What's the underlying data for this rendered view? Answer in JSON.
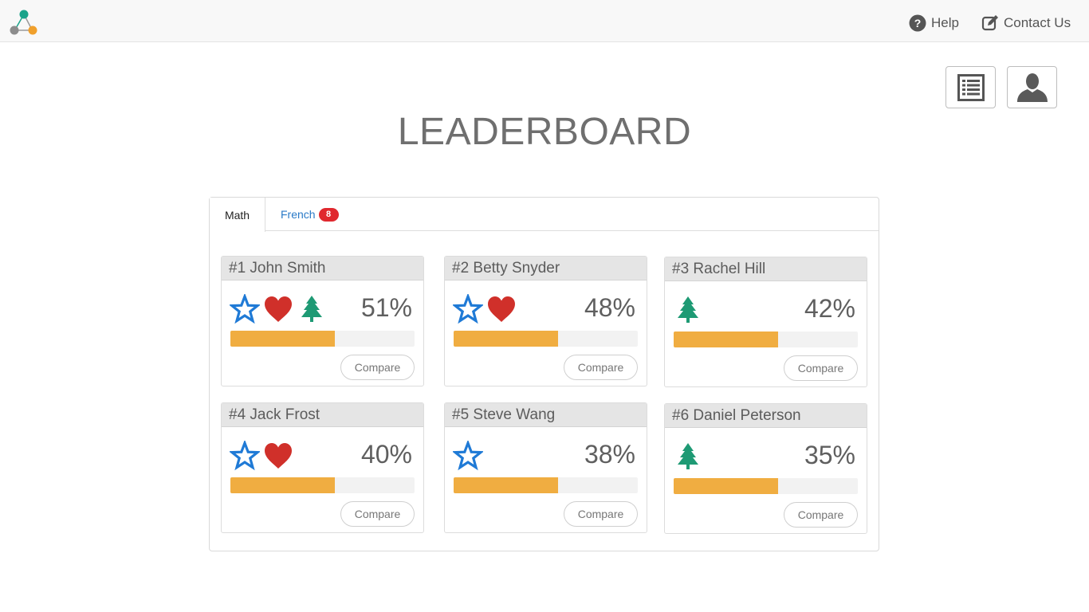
{
  "header": {
    "help_label": "Help",
    "contact_label": "Contact Us"
  },
  "page_title": "LEADERBOARD",
  "tabs": [
    {
      "label": "Math",
      "active": true
    },
    {
      "label": "French",
      "badge": "8",
      "active": false
    }
  ],
  "colors": {
    "accent_blue": "#2a7ac7",
    "badge_red": "#e0282e",
    "bar_orange": "#f0ad41",
    "star_blue": "#1f7ad6",
    "heart_red": "#d0302a",
    "tree_green": "#1e9a74"
  },
  "icon_names": {
    "star": "star-icon",
    "heart": "heart-icon",
    "tree": "tree-icon"
  },
  "compare_label": "Compare",
  "players": [
    {
      "title": "#1 John Smith",
      "percent": "51%",
      "progress": 0.565,
      "badges": [
        "star",
        "heart",
        "tree"
      ]
    },
    {
      "title": "#2 Betty Snyder",
      "percent": "48%",
      "progress": 0.565,
      "badges": [
        "star",
        "heart"
      ]
    },
    {
      "title": "#3 Rachel Hill",
      "percent": "42%",
      "progress": 0.565,
      "badges": [
        "tree"
      ]
    },
    {
      "title": "#4 Jack Frost",
      "percent": "40%",
      "progress": 0.565,
      "badges": [
        "star",
        "heart"
      ]
    },
    {
      "title": "#5 Steve Wang",
      "percent": "38%",
      "progress": 0.565,
      "badges": [
        "star"
      ]
    },
    {
      "title": "#6 Daniel Peterson",
      "percent": "35%",
      "progress": 0.565,
      "badges": [
        "tree"
      ]
    }
  ]
}
